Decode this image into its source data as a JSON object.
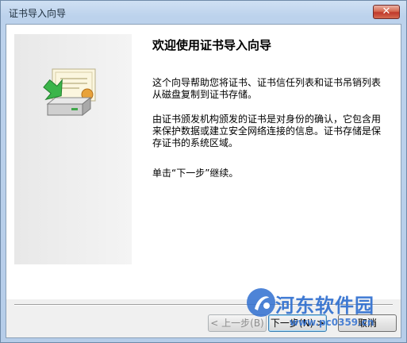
{
  "window": {
    "title": "证书导入向导",
    "close_label": "✕"
  },
  "wizard": {
    "heading": "欢迎使用证书导入向导",
    "paragraphs": [
      "这个向导帮助您将证书、证书信任列表和证书吊销列表从磁盘复制到证书存储。",
      "由证书颁发机构颁发的证书是对身份的确认，它包含用来保护数据或建立安全网络连接的信息。证书存储是保存证书的系统区域。",
      "单击“下一步”继续。"
    ]
  },
  "buttons": {
    "back": "< 上一步(B)",
    "next": "下一步(N) >",
    "cancel": "取消"
  },
  "watermark": {
    "name": "河东软件园",
    "url": "www.pc0359.cn"
  },
  "icons": {
    "wizard_icon": "certificate-import-icon",
    "close": "close-icon",
    "watermark_logo": "watermark-logo-icon"
  }
}
